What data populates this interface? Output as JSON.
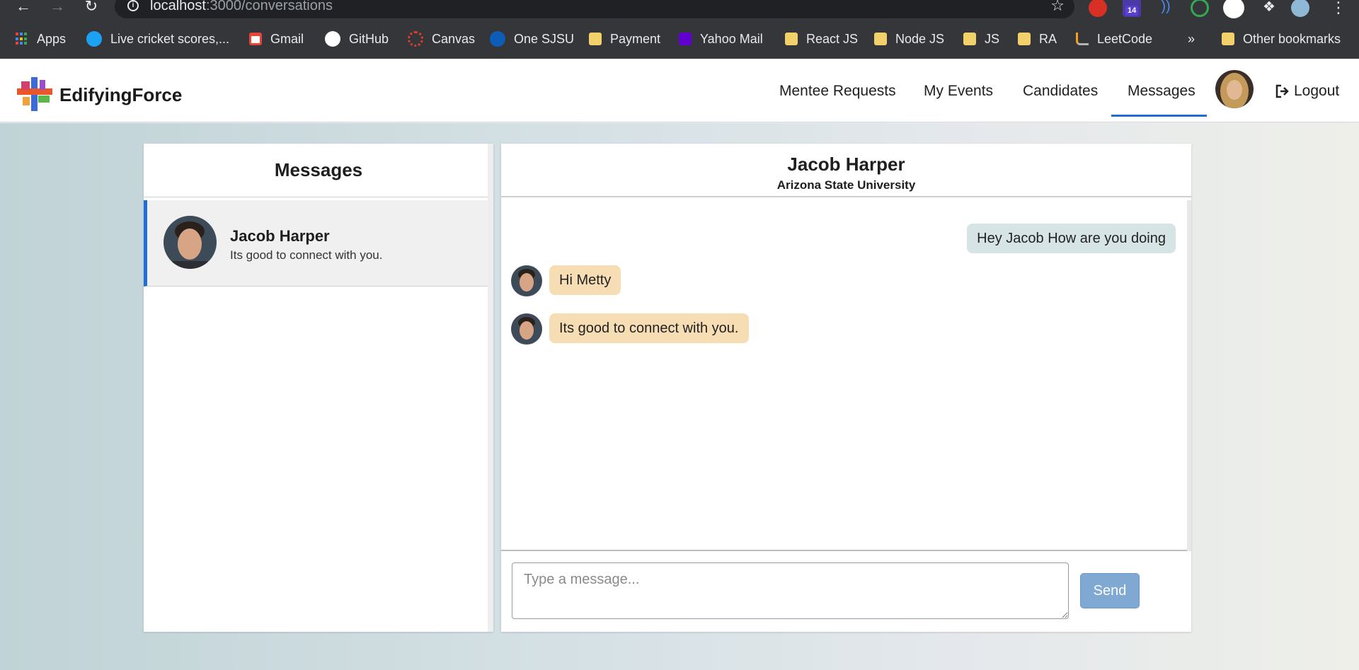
{
  "browser": {
    "url_host": "localhost",
    "url_path": ":3000/conversations",
    "extension_badge": "14",
    "bookmarks": [
      {
        "label": "Apps",
        "icon": "apps-grid-icon"
      },
      {
        "label": "Live cricket scores,...",
        "icon": "cricket-icon"
      },
      {
        "label": "Gmail",
        "icon": "gmail-icon"
      },
      {
        "label": "GitHub",
        "icon": "github-icon"
      },
      {
        "label": "Canvas",
        "icon": "canvas-icon"
      },
      {
        "label": "One SJSU",
        "icon": "sjsu-icon"
      },
      {
        "label": "Payment",
        "icon": "folder-icon"
      },
      {
        "label": "Yahoo Mail",
        "icon": "yahoo-mail-icon"
      },
      {
        "label": "React JS",
        "icon": "folder-icon"
      },
      {
        "label": "Node JS",
        "icon": "folder-icon"
      },
      {
        "label": "JS",
        "icon": "folder-icon"
      },
      {
        "label": "RA",
        "icon": "folder-icon"
      },
      {
        "label": "LeetCode",
        "icon": "leetcode-icon"
      }
    ],
    "more_bookmarks": "»",
    "other_bookmarks": "Other bookmarks"
  },
  "header": {
    "brand": "EdifyingForce",
    "nav": [
      "Mentee Requests",
      "My Events",
      "Candidates",
      "Messages"
    ],
    "active_nav": "Messages",
    "logout": "Logout"
  },
  "sidebar": {
    "title": "Messages",
    "conversations": [
      {
        "name": "Jacob Harper",
        "preview": "Its good to connect with you."
      }
    ]
  },
  "chat": {
    "name": "Jacob Harper",
    "university": "Arizona State University",
    "messages": [
      {
        "from": "me",
        "text": "Hey Jacob How are you doing"
      },
      {
        "from": "them",
        "text": "Hi Metty"
      },
      {
        "from": "them",
        "text": "Its good to connect with you."
      }
    ],
    "placeholder": "Type a message...",
    "send": "Send"
  },
  "colors": {
    "accent": "#1f6ed6",
    "bubble_out": "#d6e4e6",
    "bubble_in": "#f6ddb4",
    "send_button": "#7fa9d2"
  }
}
